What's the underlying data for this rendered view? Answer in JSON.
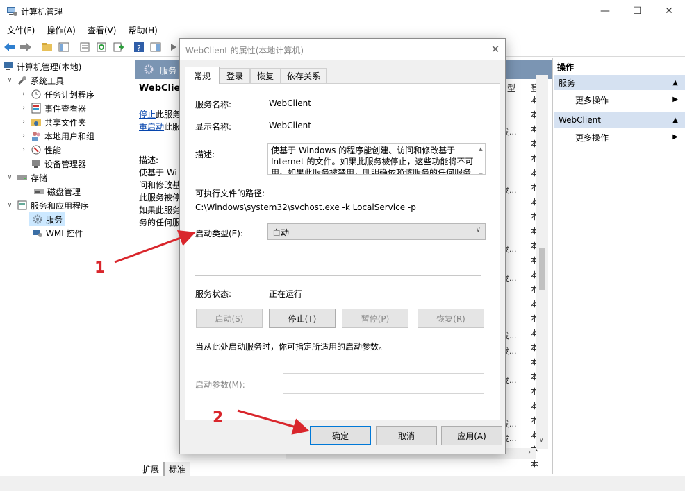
{
  "window": {
    "title": "计算机管理",
    "minimize": "—",
    "maximize": "☐",
    "close": "✕"
  },
  "menu": [
    "文件(F)",
    "操作(A)",
    "查看(V)",
    "帮助(H)"
  ],
  "tree": {
    "root": "计算机管理(本地)",
    "system_tools": "系统工具",
    "task_scheduler": "任务计划程序",
    "event_viewer": "事件查看器",
    "shared_folders": "共享文件夹",
    "local_users": "本地用户和组",
    "performance": "性能",
    "device_manager": "设备管理器",
    "storage": "存储",
    "disk_mgmt": "磁盘管理",
    "services_apps": "服务和应用程序",
    "services": "服务",
    "wmi": "WMI 控件"
  },
  "center": {
    "header": "服务",
    "service_title": "WebClient",
    "stop_link": "停止",
    "stop_rest": "此服务",
    "restart_link": "重启动",
    "restart_rest": "此服",
    "desc_label": "描述:",
    "desc_lines": [
      "使基于 Wi",
      "问和修改基",
      "此服务被停",
      "如果此服务",
      "务的任何服"
    ],
    "col_startup": "型",
    "col_logon": "登",
    "cell_startup": "发...",
    "cell_logon": "本"
  },
  "bottom_tabs": {
    "extended": "扩展",
    "standard": "标准"
  },
  "actions": {
    "title": "操作",
    "section1": "服务",
    "more1": "更多操作",
    "section2": "WebClient",
    "more2": "更多操作"
  },
  "dialog": {
    "title": "WebClient 的属性(本地计算机)",
    "tabs": [
      "常规",
      "登录",
      "恢复",
      "依存关系"
    ],
    "service_name_label": "服务名称:",
    "service_name": "WebClient",
    "display_name_label": "显示名称:",
    "display_name": "WebClient",
    "description_label": "描述:",
    "description": "使基于 Windows 的程序能创建、访问和修改基于 Internet 的文件。如果此服务被停止，这些功能将不可用。如果此服务被禁用，则明确依赖该服务的任何服务都将无法启动。",
    "path_label": "可执行文件的路径:",
    "path": "C:\\Windows\\system32\\svchost.exe -k LocalService -p",
    "startup_label": "启动类型(E):",
    "startup_value": "自动",
    "status_label": "服务状态:",
    "status_value": "正在运行",
    "btn_start": "启动(S)",
    "btn_stop": "停止(T)",
    "btn_pause": "暂停(P)",
    "btn_resume": "恢复(R)",
    "hint": "当从此处启动服务时，你可指定所适用的启动参数。",
    "params_label": "启动参数(M):",
    "params_value": "",
    "ok": "确定",
    "cancel": "取消",
    "apply": "应用(A)"
  },
  "annotations": {
    "one": "1",
    "two": "2"
  },
  "colors": {
    "accent": "#0078d7",
    "annotation": "#d9262c",
    "header_bg": "#7b95b3",
    "action_header": "#d5e1f1"
  }
}
